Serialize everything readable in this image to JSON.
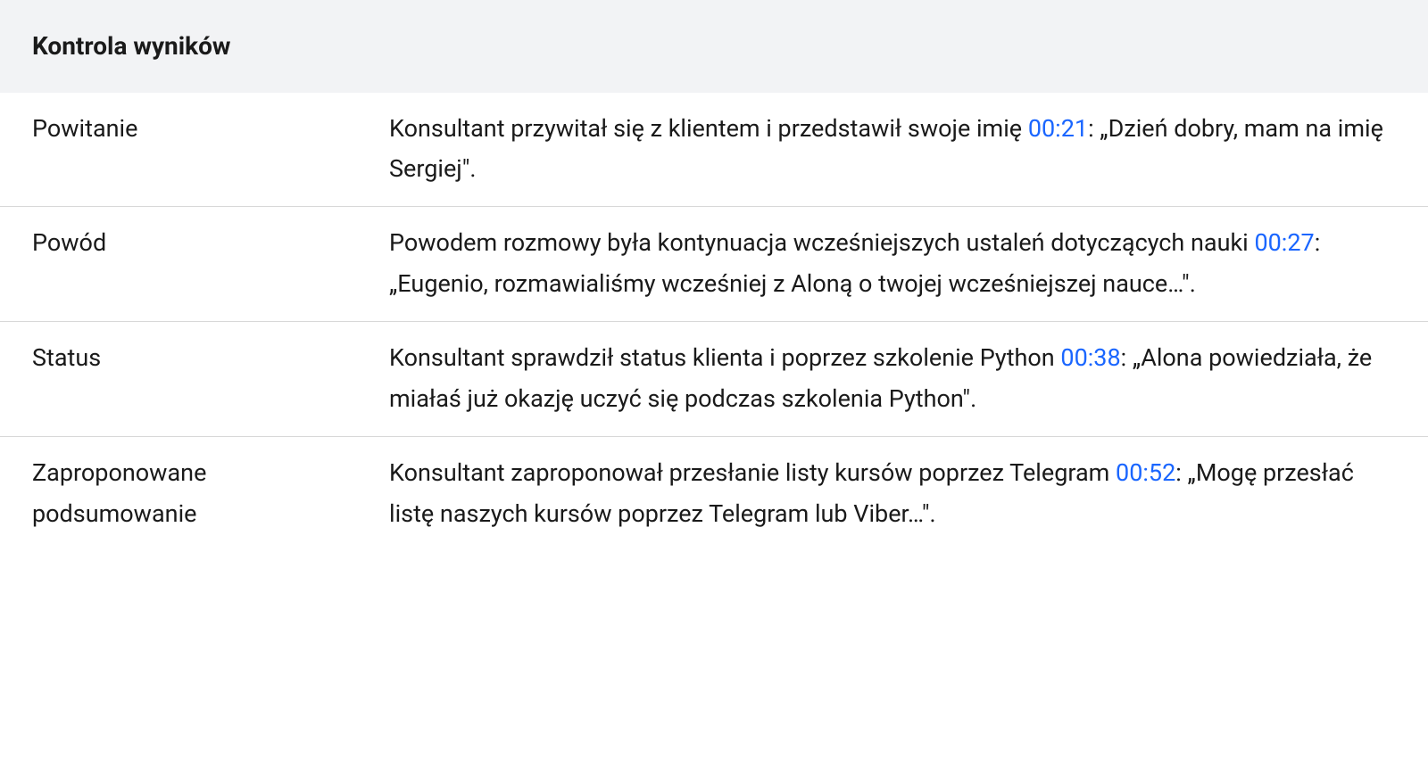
{
  "header": {
    "title": "Kontrola wyników"
  },
  "rows": [
    {
      "label": "Powitanie",
      "text_before": "Konsultant przywitał się z klientem i przedstawił swoje imię ",
      "timestamp": "00:21",
      "text_after": ": „Dzień dobry, mam na imię Sergiej\"."
    },
    {
      "label": "Powód",
      "text_before": "Powodem rozmowy była kontynuacja wcześniejszych ustaleń dotyczących nauki ",
      "timestamp": "00:27",
      "text_after": ": „Eugenio, rozmawialiśmy wcześniej z Aloną o twojej wcześniejszej nauce…\"."
    },
    {
      "label": "Status",
      "text_before": "Konsultant sprawdził status klienta i poprzez szkolenie Python ",
      "timestamp": "00:38",
      "text_after": ": „Alona powiedziała, że miałaś już okazję uczyć się podczas szkolenia Python\"."
    },
    {
      "label": "Zaproponowane podsumowanie",
      "text_before": "Konsultant zaproponował przesłanie listy kursów poprzez Telegram ",
      "timestamp": "00:52",
      "text_after": ": „Mogę przesłać listę naszych kursów poprzez Telegram lub Viber…\"."
    }
  ]
}
